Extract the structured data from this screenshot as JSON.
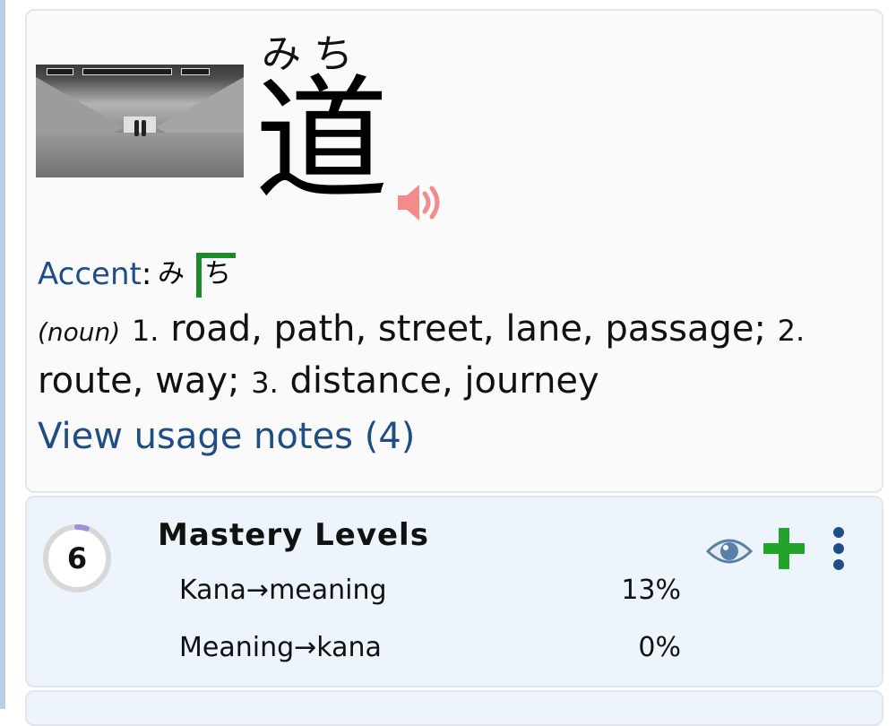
{
  "word": {
    "furigana": "みち",
    "kanji": "道",
    "accent_label": "Accent",
    "accent_colon": ":",
    "accent_mora": [
      "み",
      "ち"
    ],
    "part_of_speech": "(noun)",
    "senses": [
      {
        "num": "1.",
        "text": "road, path, street, lane, passage;"
      },
      {
        "num": "2.",
        "text": "route, way;"
      },
      {
        "num": "3.",
        "text": "distance, journey"
      }
    ],
    "usage_link": "View usage notes (4)"
  },
  "mastery": {
    "level": "6",
    "level_progress": 0.05,
    "title": "Mastery Levels",
    "rows": [
      {
        "label": "Kana→meaning",
        "percent": "13%"
      },
      {
        "label": "Meaning→kana",
        "percent": "0%"
      }
    ]
  },
  "icons": {
    "photo": "tunnel-photo",
    "speaker": "speaker-icon",
    "eye": "eye-icon",
    "add": "plus-icon",
    "more": "more-vertical-icon"
  },
  "colors": {
    "link_blue": "#1f4e86",
    "accent_green": "#1f8a2a",
    "speaker_pink": "#f28b8b",
    "add_green": "#22a32a",
    "eye_blue": "#5b7fa8",
    "progress_purple": "#9b8fd6"
  }
}
